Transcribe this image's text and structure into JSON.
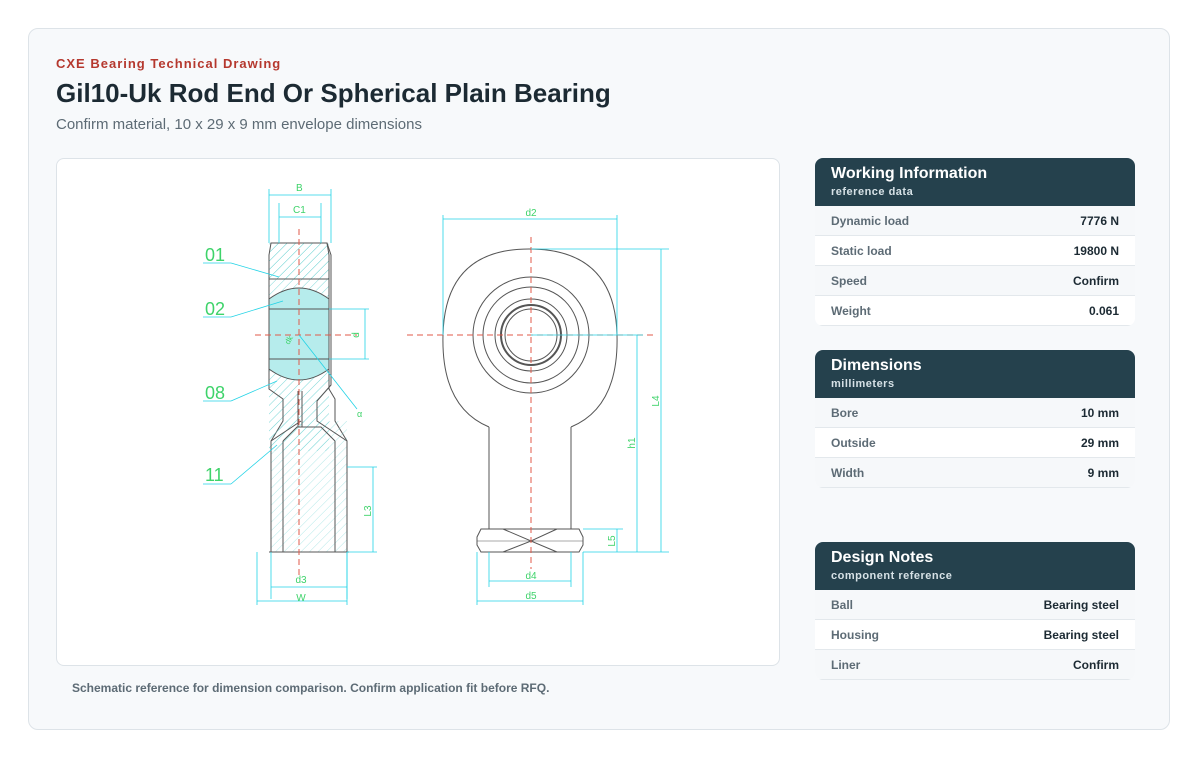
{
  "header": {
    "eyebrow": "CXE Bearing Technical Drawing",
    "title": "Gil10-Uk Rod End Or Spherical Plain Bearing",
    "subtitle": "Confirm material, 10 x 29 x 9 mm envelope dimensions"
  },
  "drawing": {
    "part_labels": [
      "01",
      "02",
      "08",
      "11"
    ],
    "dim_labels": {
      "B": "B",
      "C1": "C1",
      "d": "d",
      "dk": "dk",
      "alpha": "α",
      "L3": "L3",
      "d3": "d3",
      "W": "W",
      "d2": "d2",
      "L4": "L4",
      "h1": "h1",
      "L5": "L5",
      "d4": "d4",
      "d5": "d5"
    },
    "caption": "Schematic reference for dimension comparison. Confirm application fit before RFQ."
  },
  "colors": {
    "line": "#555555",
    "dimension": "#22d3e6",
    "part_label": "#3ed36a",
    "centerline": "#e05a4a",
    "hatch": "#7fd8d8",
    "accent": "#b5382e",
    "header_bg": "#25414d"
  },
  "working": {
    "title": "Working Information",
    "subtitle": "reference data",
    "rows": [
      {
        "label": "Dynamic load",
        "value": "7776 N"
      },
      {
        "label": "Static load",
        "value": "19800 N"
      },
      {
        "label": "Speed",
        "value": "Confirm"
      },
      {
        "label": "Weight",
        "value": "0.061"
      }
    ]
  },
  "dimensions": {
    "title": "Dimensions",
    "subtitle": "millimeters",
    "rows": [
      {
        "label": "Bore",
        "value": "10 mm"
      },
      {
        "label": "Outside",
        "value": "29 mm"
      },
      {
        "label": "Width",
        "value": "9 mm"
      }
    ]
  },
  "notes": {
    "title": "Design Notes",
    "subtitle": "component reference",
    "rows": [
      {
        "label": "Ball",
        "value": "Bearing steel"
      },
      {
        "label": "Housing",
        "value": "Bearing steel"
      },
      {
        "label": "Liner",
        "value": "Confirm"
      }
    ]
  }
}
